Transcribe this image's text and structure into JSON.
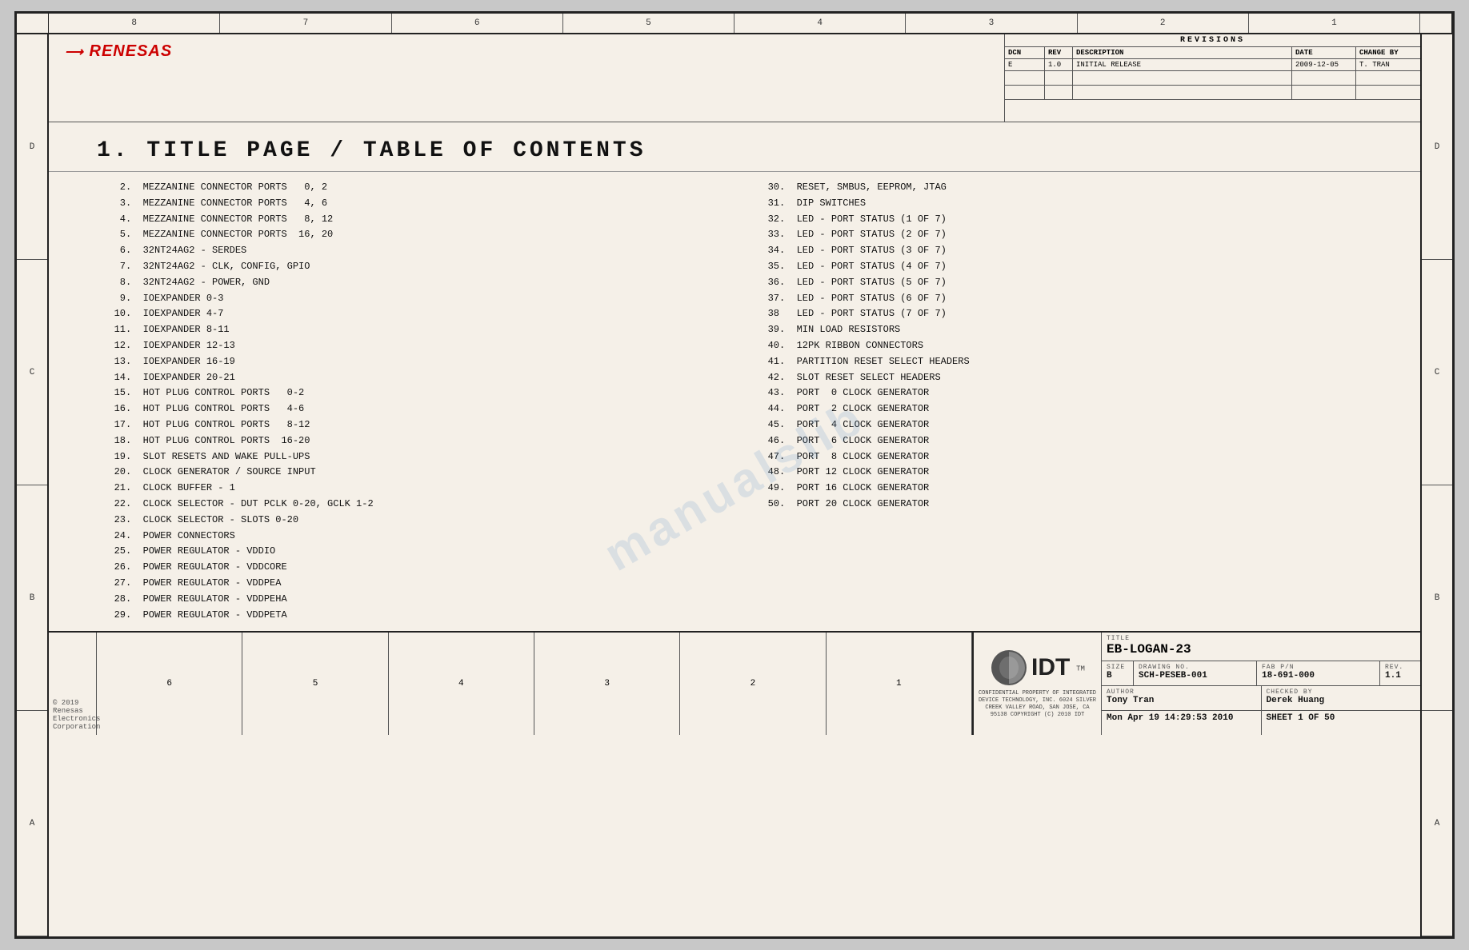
{
  "sheet": {
    "col_numbers_top": [
      "8",
      "7",
      "6",
      "5",
      "4",
      "3",
      "2",
      "1"
    ],
    "col_numbers_bottom": [
      "6",
      "5",
      "4",
      "3",
      "2",
      "1"
    ],
    "row_labels": [
      "D",
      "C",
      "B",
      "A"
    ]
  },
  "header": {
    "logo": "RENESAS",
    "revisions_title": "REVISIONS",
    "rev_headers": [
      "DCN",
      "REV",
      "DESCRIPTION",
      "DATE",
      "CHANGE BY"
    ],
    "rev_data": [
      [
        "E",
        "1.0",
        "INITIAL RELEASE",
        "2009-12-05",
        "T. TRAN"
      ]
    ]
  },
  "main_title": "1. TITLE PAGE / TABLE OF CONTENTS",
  "toc_left": "    2.  MEZZANINE CONNECTOR PORTS   0, 2\n    3.  MEZZANINE CONNECTOR PORTS   4, 6\n    4.  MEZZANINE CONNECTOR PORTS   8, 12\n    5.  MEZZANINE CONNECTOR PORTS  16, 20\n    6.  32NT24AG2 - SERDES\n    7.  32NT24AG2 - CLK, CONFIG, GPIO\n    8.  32NT24AG2 - POWER, GND\n    9.  IOEXPANDER 0-3\n   10.  IOEXPANDER 4-7\n   11.  IOEXPANDER 8-11\n   12.  IOEXPANDER 12-13\n   13.  IOEXPANDER 16-19\n   14.  IOEXPANDER 20-21\n   15.  HOT PLUG CONTROL PORTS   0-2\n   16.  HOT PLUG CONTROL PORTS   4-6\n   17.  HOT PLUG CONTROL PORTS   8-12\n   18.  HOT PLUG CONTROL PORTS  16-20\n   19.  SLOT RESETS AND WAKE PULL-UPS\n   20.  CLOCK GENERATOR / SOURCE INPUT\n   21.  CLOCK BUFFER - 1\n   22.  CLOCK SELECTOR - DUT PCLK 0-20, GCLK 1-2\n   23.  CLOCK SELECTOR - SLOTS 0-20\n   24.  POWER CONNECTORS\n   25.  POWER REGULATOR - VDDIO\n   26.  POWER REGULATOR - VDDCORE\n   27.  POWER REGULATOR - VDDPEA\n   28.  POWER REGULATOR - VDDPEHA\n   29.  POWER REGULATOR - VDDPETA",
  "toc_right": "   30.  RESET, SMBUS, EEPROM, JTAG\n   31.  DIP SWITCHES\n   32.  LED - PORT STATUS (1 OF 7)\n   33.  LED - PORT STATUS (2 OF 7)\n   34.  LED - PORT STATUS (3 OF 7)\n   35.  LED - PORT STATUS (4 OF 7)\n   36.  LED - PORT STATUS (5 OF 7)\n   37.  LED - PORT STATUS (6 OF 7)\n   38   LED - PORT STATUS (7 OF 7)\n   39.  MIN LOAD RESISTORS\n   40.  12PK RIBBON CONNECTORS\n   41.  PARTITION RESET SELECT HEADERS\n   42.  SLOT RESET SELECT HEADERS\n   43.  PORT  0 CLOCK GENERATOR\n   44.  PORT  2 CLOCK GENERATOR\n   45.  PORT  4 CLOCK GENERATOR\n   46.  PORT  6 CLOCK GENERATOR\n   47.  PORT  8 CLOCK GENERATOR\n   48.  PORT 12 CLOCK GENERATOR\n   49.  PORT 16 CLOCK GENERATOR\n   50.  PORT 20 CLOCK GENERATOR",
  "watermark": "manualslib",
  "title_block": {
    "title_label": "TITLE",
    "title_value": "EB-LOGAN-23",
    "size_label": "SIZE",
    "size_value": "B",
    "drawing_no_label": "DRAWING NO.",
    "drawing_no_value": "SCH-PESEB-001",
    "fab_pn_label": "FAB P/N",
    "fab_pn_value": "18-691-000",
    "rev_label": "REV.",
    "rev_value": "1.1",
    "author_label": "AUTHOR",
    "author_value": "Tony Tran",
    "checked_by_label": "CHECKED BY",
    "checked_by_value": "Derek Huang",
    "date_value": "Mon Apr 19 14:29:53 2010",
    "sheet_label": "SHEET 1 OF 50",
    "confidential": "CONFIDENTIAL PROPERTY OF INTEGRATED DEVICE TECHNOLOGY, INC.\n6024 SILVER CREEK VALLEY ROAD, SAN JOSE, CA 95138\nCOPYRIGHT (C) 2010 IDT"
  },
  "copyright": "© 2019 Renesas Electronics Corporation"
}
